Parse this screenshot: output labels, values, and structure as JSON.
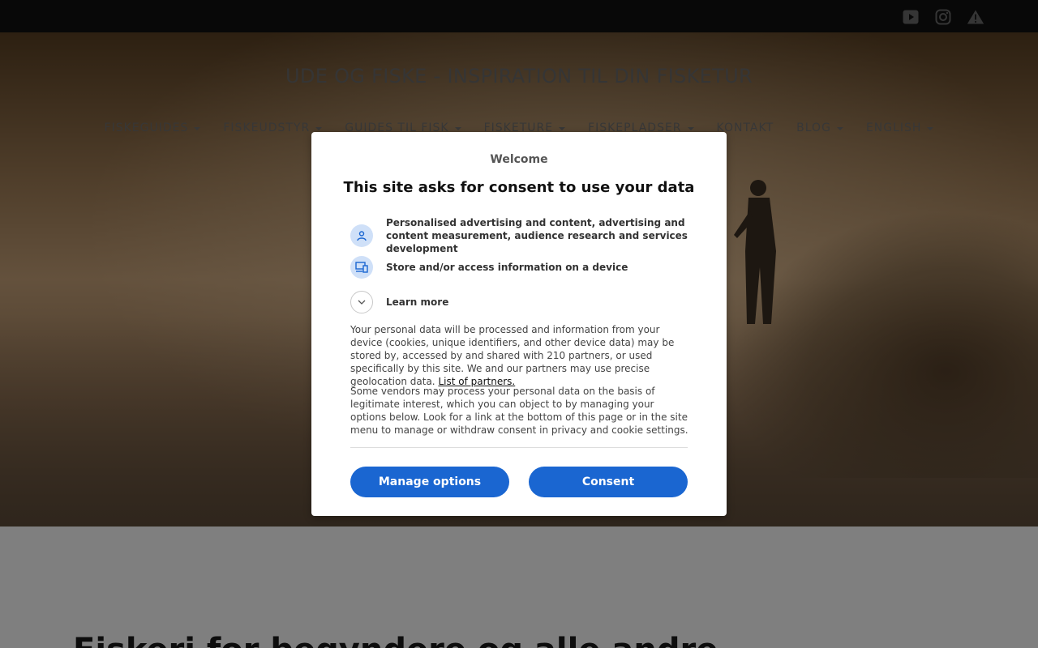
{
  "topbar": {
    "icons": [
      "youtube-icon",
      "instagram-icon",
      "warning-icon"
    ]
  },
  "site": {
    "title": "UDE OG FISKE - INSPIRATION TIL DIN FISKETUR"
  },
  "nav": {
    "items": [
      {
        "label": "FISKEGUIDES",
        "has_dropdown": true
      },
      {
        "label": "FISKEUDSTYR",
        "has_dropdown": true
      },
      {
        "label": "GUIDES TIL FISK",
        "has_dropdown": true
      },
      {
        "label": "FISKETURE",
        "has_dropdown": true
      },
      {
        "label": "FISKEPLADSER",
        "has_dropdown": true
      },
      {
        "label": "KONTAKT",
        "has_dropdown": false
      },
      {
        "label": "BLOG",
        "has_dropdown": true
      },
      {
        "label": "ENGLISH",
        "has_dropdown": true
      }
    ]
  },
  "main": {
    "heading": "Fiskeri for begyndere og alle andre"
  },
  "consent": {
    "welcome": "Welcome",
    "title": "This site asks for consent to use your data",
    "purposes": [
      {
        "icon": "person-icon",
        "text": "Personalised advertising and content, advertising and content measurement, audience research and services development"
      },
      {
        "icon": "devices-icon",
        "text": "Store and/or access information on a device"
      }
    ],
    "learn_more": "Learn more",
    "paragraph1": "Your personal data will be processed and information from your device (cookies, unique identifiers, and other device data) may be stored by, accessed by and shared with 210 partners, or used specifically by this site. We and our partners may use precise geolocation data.",
    "partners_link": "List of partners.",
    "paragraph2": "Some vendors may process your personal data on the basis of legitimate interest, which you can object to by managing your options below. Look for a link at the bottom of this page or in the site menu to manage or withdraw consent in privacy and cookie settings.",
    "manage_button": "Manage options",
    "consent_button": "Consent"
  },
  "colors": {
    "topbar": "#111111",
    "overlay": "rgba(0,0,0,0.5)",
    "button": "#1a66d1",
    "icon_bg": "#cfe0f8"
  }
}
